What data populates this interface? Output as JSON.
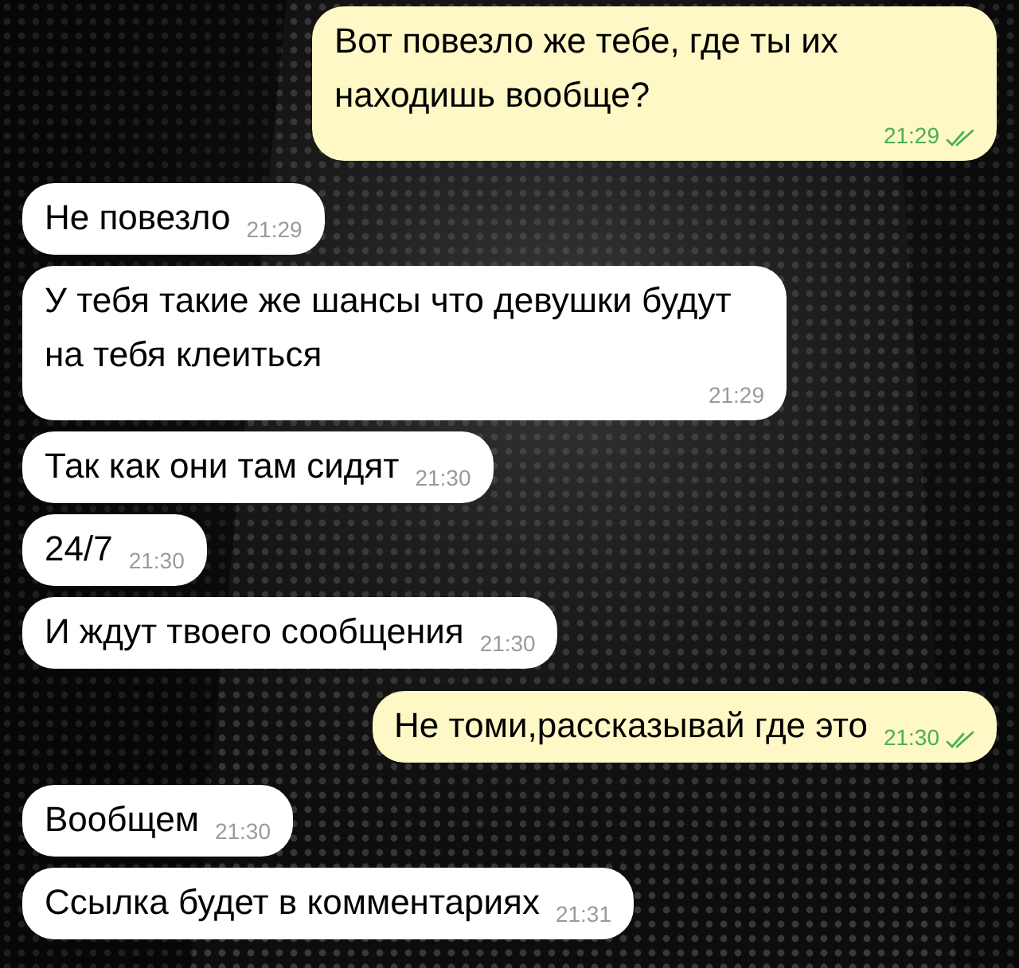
{
  "messages": [
    {
      "kind": "outgoing",
      "text": "Вот повезло же тебе, где ты их находишь вообще?",
      "time": "21:29",
      "read": true
    },
    {
      "kind": "incoming",
      "text": "Не повезло",
      "time": "21:29"
    },
    {
      "kind": "incoming",
      "text": "У тебя такие же шансы что девушки будут на тебя клеиться",
      "time": "21:29"
    },
    {
      "kind": "incoming",
      "text": "Так как они там сидят",
      "time": "21:30"
    },
    {
      "kind": "incoming",
      "text": "24/7",
      "time": "21:30"
    },
    {
      "kind": "incoming",
      "text": "И ждут твоего сообщения",
      "time": "21:30"
    },
    {
      "kind": "outgoing",
      "text": "Не томи,рассказывай где это",
      "time": "21:30",
      "read": true
    },
    {
      "kind": "incoming",
      "text": "Вообщем",
      "time": "21:30"
    },
    {
      "kind": "incoming",
      "text": "Ссылка будет в комментариях",
      "time": "21:31"
    }
  ]
}
